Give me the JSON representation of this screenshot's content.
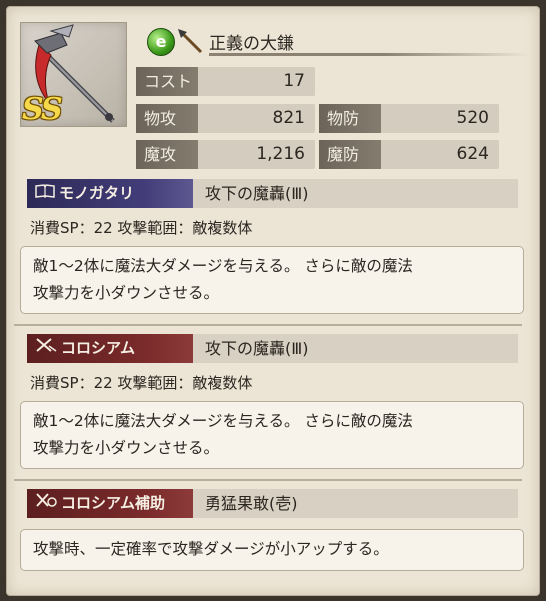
{
  "weapon": {
    "name": "正義の大鎌",
    "rarity": "SS",
    "element_icon": "e",
    "element_color": "#3b9a1a",
    "type_icon": "spear-icon",
    "portrait_icon": "scythe-icon"
  },
  "stats": {
    "cost_label": "コスト",
    "cost_value": "17",
    "patk_label": "物攻",
    "patk_value": "821",
    "pdef_label": "物防",
    "pdef_value": "520",
    "matk_label": "魔攻",
    "matk_value": "1,216",
    "mdef_label": "魔防",
    "mdef_value": "624"
  },
  "story_skill": {
    "tag": "モノガタリ",
    "tag_icon": "book-icon",
    "name": "攻下の魔轟(Ⅲ)",
    "meta": "消費SP：22  攻撃範囲：敵複数体",
    "desc_line1": "敵1～2体に魔法大ダメージを与える。 さらに敵の魔法",
    "desc_line2": "攻撃力を小ダウンさせる。"
  },
  "colosseum_skill": {
    "tag": "コロシアム",
    "tag_icon": "crossed-swords-icon",
    "name": "攻下の魔轟(Ⅲ)",
    "meta": "消費SP：22  攻撃範囲：敵複数体",
    "desc_line1": "敵1～2体に魔法大ダメージを与える。 さらに敵の魔法",
    "desc_line2": "攻撃力を小ダウンさせる。"
  },
  "colosseum_support": {
    "tag": "コロシアム補助",
    "tag_icon": "support-swords-icon",
    "name": "勇猛果敢(壱)",
    "desc": "攻撃時、一定確率で攻撃ダメージが小アップする。"
  }
}
